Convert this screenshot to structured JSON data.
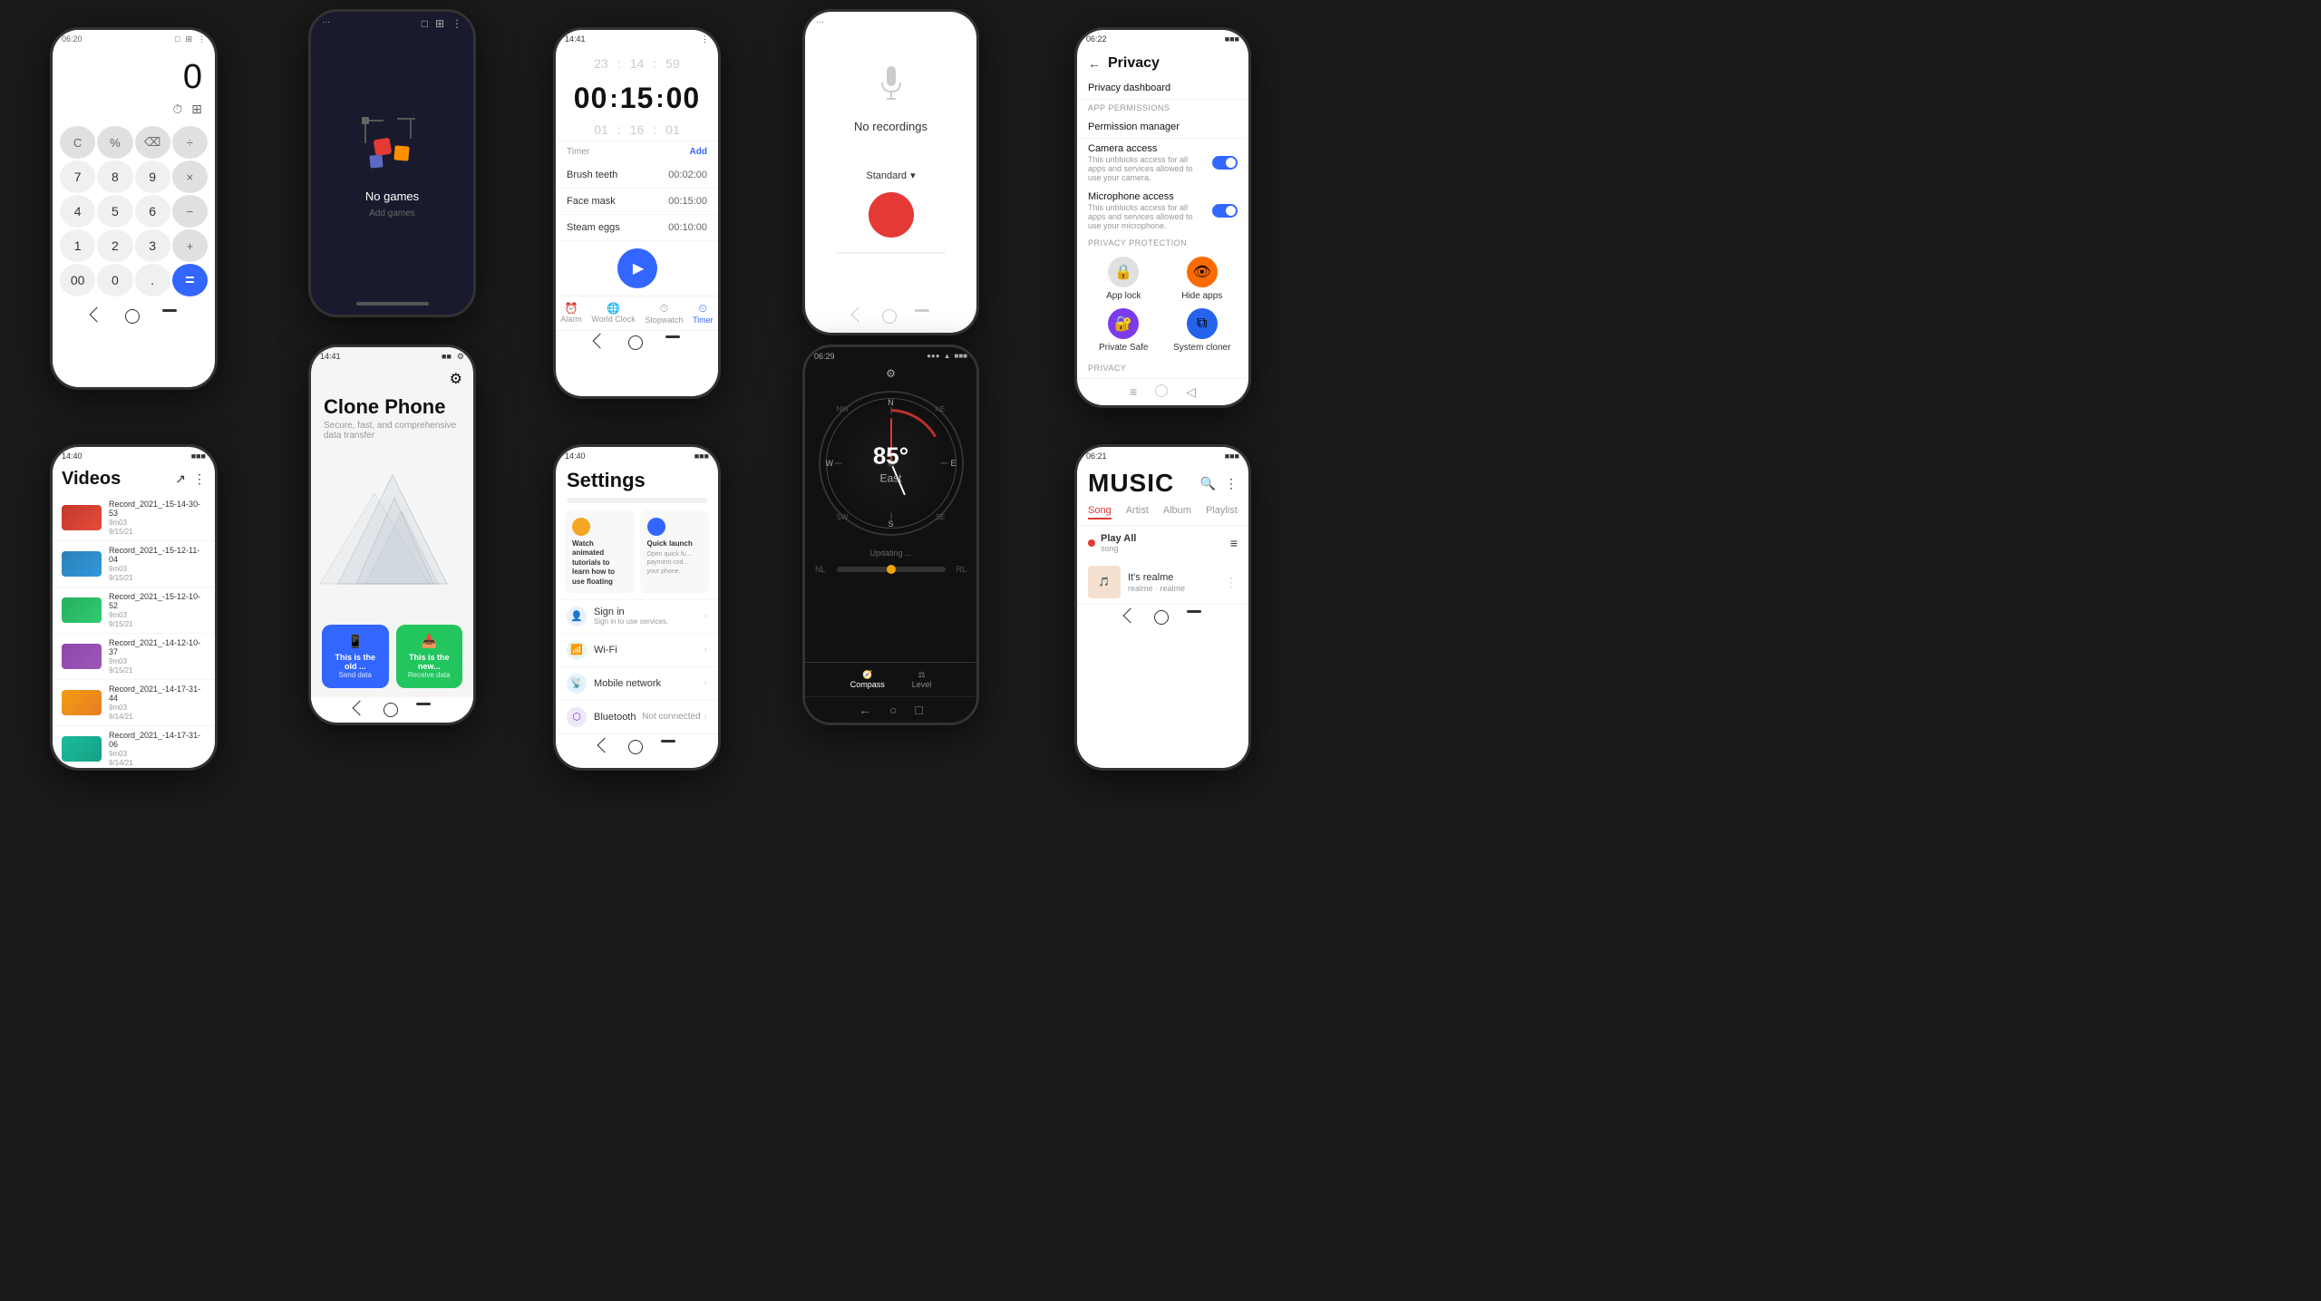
{
  "background": "#1a1a1a",
  "phones": {
    "calculator": {
      "status": {
        "time": "06:20",
        "battery": "■■■"
      },
      "display": "0",
      "buttons_row1": [
        "C",
        "%",
        "⌫",
        "÷"
      ],
      "buttons_row2": [
        "7",
        "8",
        "9",
        "×"
      ],
      "buttons_row3": [
        "4",
        "5",
        "6",
        "−"
      ],
      "buttons_row4": [
        "1",
        "2",
        "3",
        "+"
      ],
      "buttons_row5": [
        "00",
        "0",
        ".",
        "="
      ]
    },
    "games": {
      "status": {
        "time": "---"
      },
      "no_games": "No games",
      "add_games": "Add games"
    },
    "timer": {
      "status": {
        "time": "14:41"
      },
      "scroll_top": [
        "23",
        "14",
        "59"
      ],
      "main_time": [
        "00",
        "15",
        "00"
      ],
      "scroll_bottom": [
        "01",
        "16",
        "01"
      ],
      "header_label": "Timer",
      "add_label": "Add",
      "items": [
        {
          "name": "Brush teeth",
          "time": "00:02:00"
        },
        {
          "name": "Face mask",
          "time": "00:15:00"
        },
        {
          "name": "Steam eggs",
          "time": "00:10:00"
        }
      ],
      "tabs": [
        "Alarm",
        "World Clock",
        "Stopwatch",
        "Timer"
      ]
    },
    "voice_recorder": {
      "status": {
        "time": "---"
      },
      "no_recordings": "No recordings",
      "mode": "Standard",
      "mic_label": "🎤"
    },
    "privacy": {
      "status": {
        "time": "06:22"
      },
      "back_label": "Privacy",
      "privacy_dashboard": "Privacy dashboard",
      "app_permissions_label": "APP PERMISSIONS",
      "permission_manager": "Permission manager",
      "camera_access": "Camera access",
      "camera_sub": "This unblocks access for all apps and services allowed to use your camera.",
      "microphone_access": "Microphone access",
      "microphone_sub": "This unblocks access for all apps and services allowed to use your microphone.",
      "privacy_protection_label": "PRIVACY PROTECTION",
      "app_lock": "App lock",
      "hide_apps": "Hide apps",
      "private_safe": "Private Safe",
      "system_cloner": "System cloner",
      "privacy_section": "PRIVACY"
    },
    "videos": {
      "status": {
        "time": "14:40"
      },
      "title": "Videos",
      "items": [
        {
          "name": "Record_2021_-15-14-30-53",
          "size": "9m03",
          "date": "9/15/21"
        },
        {
          "name": "Record_2021_-15-12-11-04",
          "size": "9m03",
          "date": "9/15/21"
        },
        {
          "name": "Record_2021_-15-12-10-52",
          "size": "9m03",
          "date": "9/15/21"
        },
        {
          "name": "Record_2021_-14-12-10-37",
          "size": "9m03",
          "date": "9/15/21"
        },
        {
          "name": "Record_2021_-14-17-31-44",
          "size": "9m03",
          "date": "9/14/21"
        },
        {
          "name": "Record_2021_-14-17-31-06",
          "size": "9m03",
          "date": "9/14/21"
        }
      ]
    },
    "clone_phone": {
      "status": {
        "time": "14:41"
      },
      "title": "Clone Phone",
      "subtitle": "Secure, fast, and comprehensive data transfer",
      "btn1_title": "This is the old ...",
      "btn1_sub": "Send data",
      "btn2_title": "This is the new...",
      "btn2_sub": "Receive data"
    },
    "settings": {
      "status": {
        "time": "14:40"
      },
      "title": "Settings",
      "feature1_title": "Watch animated tutorials to learn how to use floating",
      "feature1_icon": "🎬",
      "feature2_title": "Quick launch",
      "feature2_sub": "Open quick fu... payment cod... your phone.",
      "feature2_icon": "⚡",
      "items": [
        {
          "icon": "📶",
          "label": "Sign in",
          "sub": "Sign in to use services.",
          "value": ""
        },
        {
          "icon": "📡",
          "label": "Wi-Fi",
          "value": ""
        },
        {
          "icon": "📱",
          "label": "Mobile network",
          "value": ""
        },
        {
          "icon": "🔵",
          "label": "Bluetooth",
          "value": "Not connected"
        }
      ]
    },
    "compass": {
      "status": {
        "time": "06:29"
      },
      "degrees": "85°",
      "direction": "East",
      "updating": "Updating ...",
      "tabs": [
        "Compass",
        "Level"
      ]
    },
    "music": {
      "status": {
        "time": "06:21"
      },
      "title": "MUSIC",
      "tabs": [
        "Song",
        "Artist",
        "Album",
        "Playlist"
      ],
      "play_all": "Play All",
      "play_all_sub": "song",
      "songs": [
        {
          "title": "It's realme",
          "artist": "realme · realme"
        }
      ]
    }
  },
  "icons": {
    "back": "←",
    "more": "⋮",
    "search": "🔍",
    "settings": "⚙",
    "share": "↗",
    "list": "≡",
    "check": "✓",
    "arrow_right": "›",
    "dropdown": "▾",
    "play": "▶",
    "phone_icon": "📱",
    "send_icon": "📤",
    "receive_icon": "📥",
    "lock_icon": "🔒",
    "eye_off": "👁",
    "safe_icon": "🔐",
    "clone_icon": "⧉"
  }
}
